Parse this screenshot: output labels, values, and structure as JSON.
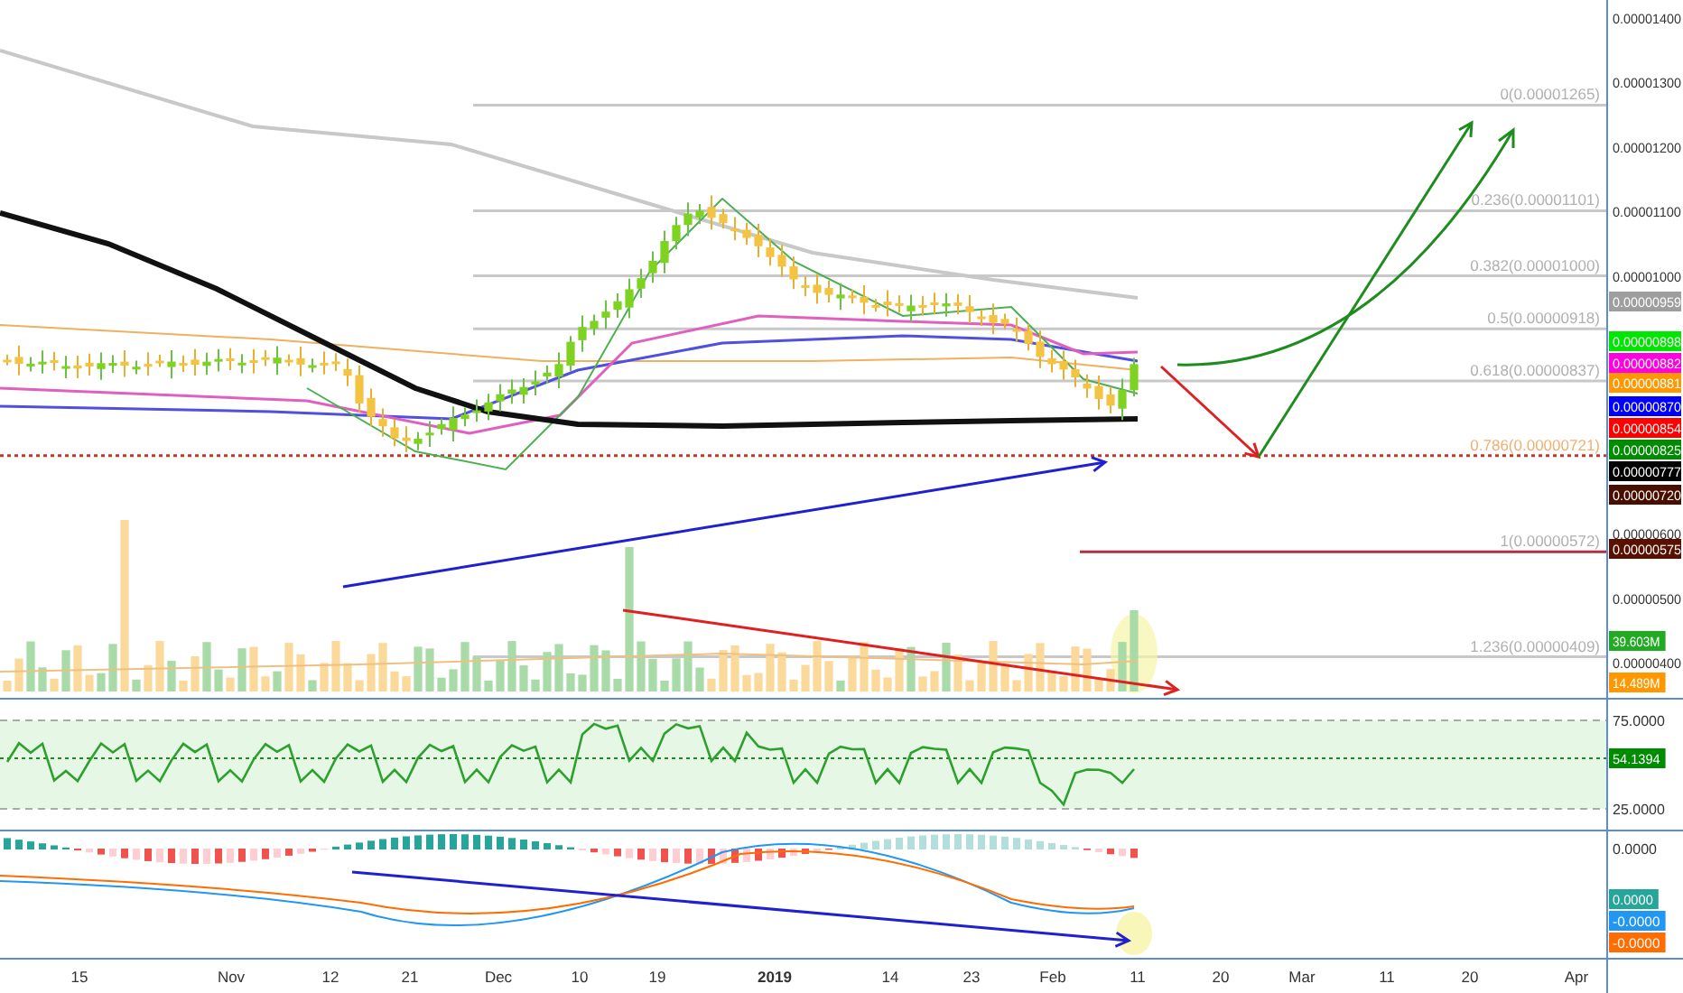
{
  "chart": {
    "fib_levels": [
      {
        "label": "0(0.00001265)",
        "color": "#b0b0b0"
      },
      {
        "label": "0.236(0.00001101)",
        "color": "#b0b0b0"
      },
      {
        "label": "0.382(0.00001000)",
        "color": "#b0b0b0"
      },
      {
        "label": "0.5(0.00000918)",
        "color": "#b0b0b0"
      },
      {
        "label": "0.618(0.00000837)",
        "color": "#b0b0b0"
      },
      {
        "label": "0.786(0.00000721)",
        "color": "#f0b070"
      },
      {
        "label": "1(0.00000572)",
        "color": "#b0b0b0"
      },
      {
        "label": "1.236(0.00000409)",
        "color": "#b0b0b0"
      }
    ],
    "price_axis": [
      "0.00001400",
      "0.00001300",
      "0.00001200",
      "0.00001100",
      "0.00001000",
      "0.00000600",
      "0.00000500",
      "0.00000400"
    ],
    "price_tags": [
      {
        "text": "0.00000959",
        "color": "#9e9e9e"
      },
      {
        "text": "0.00000898",
        "color": "#00e600"
      },
      {
        "text": "0.00000882",
        "color": "#ff00e0"
      },
      {
        "text": "0.00000881",
        "color": "#ff9800"
      },
      {
        "text": "0.00000870",
        "color": "#0000ff"
      },
      {
        "text": "0.00000854",
        "color": "#ff0000"
      },
      {
        "text": "0.00000825",
        "color": "#008c00"
      },
      {
        "text": "0.00000777",
        "color": "#000000"
      },
      {
        "text": "0.00000720",
        "color": "#4a0e00"
      },
      {
        "text": "0.00000575",
        "color": "#5a1000"
      }
    ],
    "volume_tags": [
      {
        "text": "39.603M",
        "color": "#22aa22"
      },
      {
        "text": "14.489M",
        "color": "#ff9800"
      }
    ],
    "rsi_axis": [
      "75.0000",
      "25.0000"
    ],
    "rsi_tags": [
      {
        "text": "54.1394",
        "color": "#008c00"
      }
    ],
    "macd_axis": [
      "0.0000"
    ],
    "macd_tags": [
      {
        "text": "0.0000",
        "color": "#26a69a"
      },
      {
        "text": "-0.0000",
        "color": "#2196f3"
      },
      {
        "text": "-0.0000",
        "color": "#ff6d00"
      }
    ],
    "time_axis": [
      {
        "label": "15",
        "bold": false
      },
      {
        "label": "Nov",
        "bold": false
      },
      {
        "label": "12",
        "bold": false
      },
      {
        "label": "21",
        "bold": false
      },
      {
        "label": "Dec",
        "bold": false
      },
      {
        "label": "10",
        "bold": false
      },
      {
        "label": "19",
        "bold": false
      },
      {
        "label": "2019",
        "bold": true
      },
      {
        "label": "14",
        "bold": false
      },
      {
        "label": "23",
        "bold": false
      },
      {
        "label": "Feb",
        "bold": false
      },
      {
        "label": "11",
        "bold": false
      },
      {
        "label": "20",
        "bold": false
      },
      {
        "label": "Mar",
        "bold": false
      },
      {
        "label": "11",
        "bold": false
      },
      {
        "label": "20",
        "bold": false
      },
      {
        "label": "Apr",
        "bold": false
      }
    ]
  }
}
